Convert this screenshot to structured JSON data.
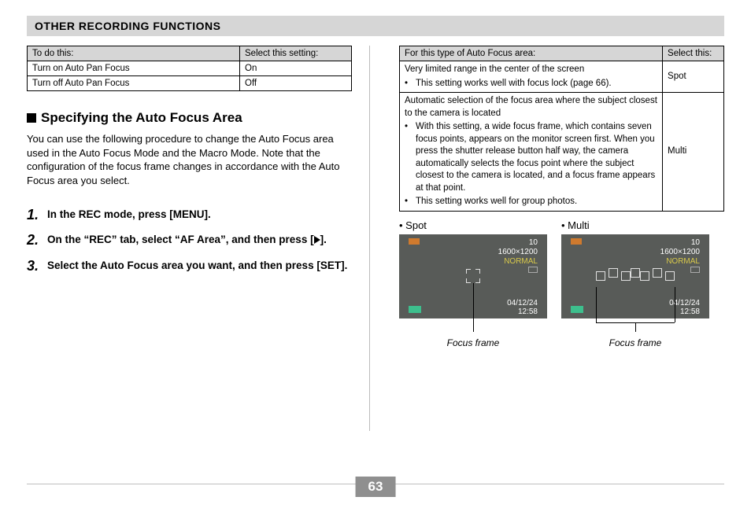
{
  "header": {
    "title": "OTHER RECORDING FUNCTIONS"
  },
  "left": {
    "table": {
      "headers": [
        "To do this:",
        "Select this setting:"
      ],
      "rows": [
        [
          "Turn on Auto Pan Focus",
          "On"
        ],
        [
          "Turn off Auto Pan Focus",
          "Off"
        ]
      ]
    },
    "subtitle": "Specifying the Auto Focus Area",
    "paragraph": "You can use the following procedure to change the Auto Focus area used in the Auto Focus Mode and the Macro Mode. Note that the configuration of the focus frame changes in accordance with the Auto Focus area you select.",
    "steps": [
      {
        "num": "1.",
        "text": "In the REC mode, press [MENU]."
      },
      {
        "num": "2.",
        "text_a": "On the “REC” tab, select “AF Area”, and then press "
      },
      {
        "num": "3.",
        "text": "Select the Auto Focus area you want, and then press [SET]."
      }
    ]
  },
  "right": {
    "table": {
      "headers": [
        "For this type of Auto Focus area:",
        "Select this:"
      ],
      "rows": [
        {
          "desc": "Very limited range in the center of the screen",
          "bullet": "This setting works well with focus lock (page 66).",
          "setting": "Spot"
        },
        {
          "desc": "Automatic selection of the focus area where the subject closest to the camera is located",
          "bullet1": "With this setting, a wide focus frame, which contains seven focus points, appears on the monitor screen first.  When you press the shutter release button half way, the camera automatically selects the focus point where the subject closest to the camera is located, and a focus frame appears at that point.",
          "bullet2": "This setting works well for group photos.",
          "setting": "Multi"
        }
      ]
    },
    "screens": [
      {
        "label": "Spot",
        "shots": "10",
        "resolution": "1600×1200",
        "quality": "NORMAL",
        "date": "04/12/24",
        "time": "12:58"
      },
      {
        "label": "Multi",
        "shots": "10",
        "resolution": "1600×1200",
        "quality": "NORMAL",
        "date": "04/12/24",
        "time": "12:58"
      }
    ],
    "focus_frame_label": "Focus frame"
  },
  "page_number": "63"
}
